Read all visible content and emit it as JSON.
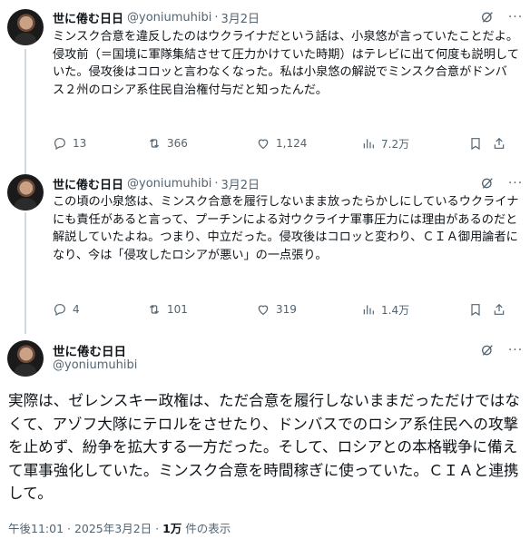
{
  "tweets": [
    {
      "name": "世に倦む日日",
      "handle": "@yoniumuhibi",
      "separator": "·",
      "date": "3月2日",
      "text": "ミンスク合意を違反したのはウクライナだという話は、小泉悠が言っていたことだよ。侵攻前（＝国境に軍隊集結させて圧力かけていた時期）はテレビに出て何度も説明していた。侵攻後はコロッと言わなくなった。私は小泉悠の解説でミンスク合意がドンバス２州のロシア系住民自治権付与だと知ったんだ。",
      "replies": "13",
      "reposts": "366",
      "likes": "1,124",
      "views": "7.2万"
    },
    {
      "name": "世に倦む日日",
      "handle": "@yoniumuhibi",
      "separator": "·",
      "date": "3月2日",
      "text": "この頃の小泉悠は、ミンスク合意を履行しないまま放ったらかしにしているウクライナにも責任があると言って、プーチンによる対ウクライナ軍事圧力には理由があるのだと解説していたよね。つまり、中立だった。侵攻後はコロッと変わり、ＣＩＡ御用論者になり、今は「侵攻したロシアが悪い」の一点張り。",
      "replies": "4",
      "reposts": "101",
      "likes": "319",
      "views": "1.4万"
    }
  ],
  "main": {
    "name": "世に倦む日日",
    "handle": "@yoniumuhibi",
    "text": "実際は、ゼレンスキー政権は、ただ合意を履行しないままだっただけではなくて、アゾフ大隊にテロルをさせたり、ドンバスでのロシア系住民への攻撃を止めず、紛争を拡大する一方だった。そして、ロシアとの本格戦争に備えて軍事強化していた。ミンスク合意を時間稼ぎに使っていた。ＣＩＡと連携して。",
    "time": "午後11:01 · 2025年3月2日 · ",
    "view_count": "1万",
    "view_suffix": " 件の表示"
  },
  "icons": [
    "grok-icon",
    "more-icon",
    "reply-icon",
    "repost-icon",
    "like-icon",
    "views-icon",
    "bookmark-icon",
    "share-icon"
  ],
  "colors": {
    "text": "#0f1419",
    "secondary": "#536471",
    "thread_line": "#cfd9de",
    "background": "#ffffff"
  }
}
